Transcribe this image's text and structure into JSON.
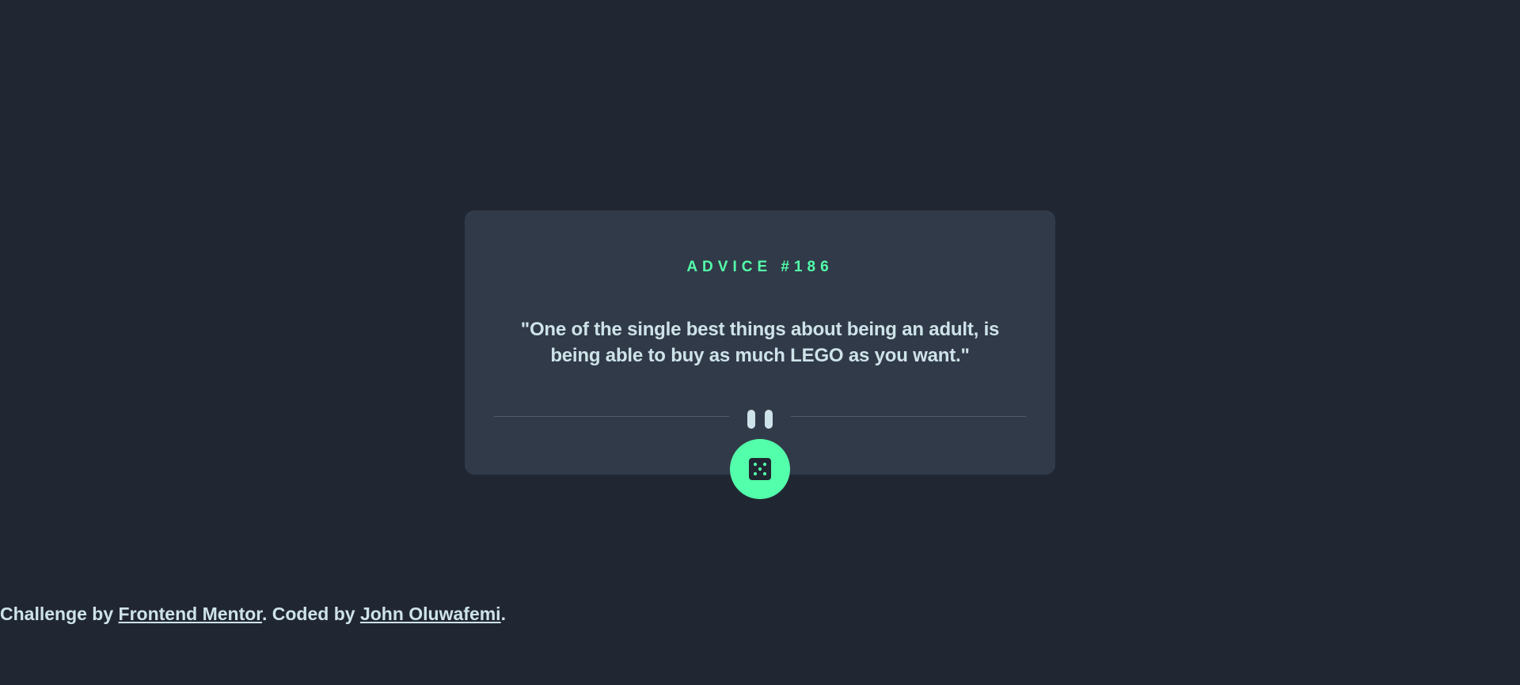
{
  "card": {
    "advice_id": "ADVICE #186",
    "advice_text": "\"One of the single best things about being an adult, is being able to buy as much LEGO as you want.\""
  },
  "divider": {
    "icon": "pause-icon"
  },
  "button": {
    "icon": "dice-icon"
  },
  "footer": {
    "prefix": "Challenge by ",
    "link_1": "Frontend Mentor",
    "middle": ". Coded by ",
    "link_2": "John Oluwafemi",
    "suffix": "."
  },
  "colors": {
    "background": "#202632",
    "card": "#313a48",
    "accent": "#53ffaa",
    "text": "#cee3e9",
    "divider": "#4f5d74"
  }
}
